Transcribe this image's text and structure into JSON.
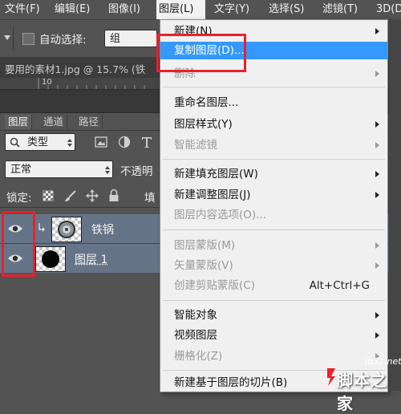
{
  "menubar": [
    "文件(F)",
    "编辑(E)",
    "图像(I)",
    "图层(L)",
    "文字(Y)",
    "选择(S)",
    "滤镜(T)",
    "3D(D"
  ],
  "options": {
    "auto_select_label": "自动选择:",
    "auto_select_value": "组"
  },
  "document_tab": "要用的素材1.jpg @ 15.7% (铁",
  "ruler": {
    "tick_label": "10"
  },
  "layers_panel": {
    "tabs": [
      "图层",
      "通道",
      "路径"
    ],
    "filter_type": "类型",
    "blend_mode": "正常",
    "opacity_label": "不透明",
    "lock_label": "锁定:",
    "fill_partial": "填",
    "layers": [
      {
        "name": "铁锅",
        "selected": true
      },
      {
        "name": "图层 1",
        "selected": true
      }
    ]
  },
  "dropdown": {
    "items": [
      {
        "label": "新建(N)",
        "disabled": false,
        "submenu": true
      },
      {
        "label": "复制图层(D)...",
        "disabled": false,
        "submenu": false,
        "highlighted": true
      },
      {
        "label": "删除",
        "disabled": true,
        "submenu": true
      },
      {
        "label": "重命名图层...",
        "disabled": false,
        "submenu": false
      },
      {
        "label": "图层样式(Y)",
        "disabled": false,
        "submenu": true
      },
      {
        "label": "智能滤镜",
        "disabled": true,
        "submenu": true
      },
      {
        "label": "新建填充图层(W)",
        "disabled": false,
        "submenu": true
      },
      {
        "label": "新建调整图层(J)",
        "disabled": false,
        "submenu": true
      },
      {
        "label": "图层内容选项(O)...",
        "disabled": true,
        "submenu": false
      },
      {
        "label": "图层蒙版(M)",
        "disabled": true,
        "submenu": true
      },
      {
        "label": "矢量蒙版(V)",
        "disabled": true,
        "submenu": true
      },
      {
        "label": "创建剪贴蒙版(C)",
        "disabled": true,
        "submenu": false,
        "shortcut": "Alt+Ctrl+G"
      },
      {
        "label": "智能对象",
        "disabled": false,
        "submenu": true
      },
      {
        "label": "视频图层",
        "disabled": false,
        "submenu": true
      },
      {
        "label": "栅格化(Z)",
        "disabled": true,
        "submenu": true
      },
      {
        "label": "新建基于图层的切片(B)",
        "disabled": false,
        "submenu": false
      }
    ]
  },
  "watermark": {
    "site": "jb51.net",
    "brand": "脚本之家"
  },
  "colors": {
    "highlight": "#3399ff",
    "annotation_red": "#e8212b",
    "panel_bg": "#535353"
  }
}
